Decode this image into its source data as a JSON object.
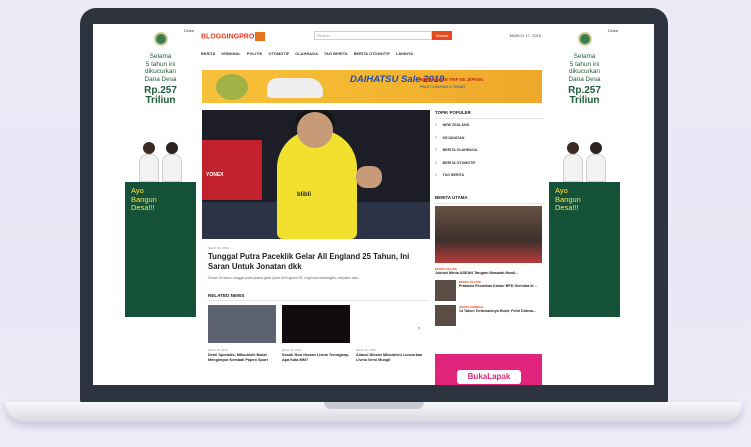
{
  "site": {
    "logo_text": "BLOGGINGPRO",
    "search_placeholder": "Search",
    "search_button": "Search",
    "date": "MARCH 17, 2019"
  },
  "nav": [
    "BERITA",
    "KRIMINAL",
    "POLITIK",
    "OTOMOTIF",
    "OLAHRAGA",
    "TAG BERITA",
    "BERITA OTOMOTIF",
    "LAINNYA"
  ],
  "side_ad": {
    "close": "Close",
    "line1": "Selama",
    "line2": "5 tahun ini",
    "line3": "dikucurkan",
    "line4": "Dana Desa",
    "big1": "Rp.257",
    "big2": "Triliun",
    "green1": "Ayo",
    "green2": "Bangun",
    "green3": "Desa!!!"
  },
  "banner": {
    "brand": "DAIHATSU Sale 2019",
    "sub": "MENANGKAN TRIP KE JEPANG",
    "sub2": "PAKET LIBURAN 4 ORANG"
  },
  "hero": {
    "sponsor": "blibli",
    "board": "YONEX"
  },
  "article": {
    "date": "March 16, 2019",
    "title": "Tunggal Putra Paceklik Gelar All England 25 Tahun, Ini Saran Untuk Jonatan dkk",
    "excerpt": "Sudah 25 tahun tunggal putra puasa gelar juara All England 25. Legenda bulutangkis, meyakini ada..."
  },
  "related": {
    "heading": "RELATED NEWS",
    "items": [
      {
        "date": "March 16, 2019",
        "title": "Demi Sporadis, Mitsubishi Bakal Mengimpor Kembali Pajero Sport"
      },
      {
        "date": "March 16, 2019",
        "title": "Sosok New Nissan Livina Terungkap, Apa Kata MM?"
      },
      {
        "date": "March 16, 2019",
        "title": "Aliansi Nissan Mitsubishi Luncurkan Livina Versi Mungil"
      }
    ]
  },
  "sidebar": {
    "topik_heading": "TOPIK POPULER",
    "topik": [
      "NEW ZEALAND",
      "KEJAHATAN",
      "BERITA OLAHRAGA",
      "BERITA OTOMOTIF",
      "TAG BERITA"
    ],
    "utama_heading": "BERITA UTAMA",
    "utama": [
      {
        "cat": "BERITA POLITIK",
        "title": "Jokowi Minta ASEAN Tangani Masalah Musli..."
      },
      {
        "cat": "BERITA POLITIK",
        "title": "Prabowo Resmikan Kantor BPD Gerindra di ..."
      },
      {
        "cat": "BERITA KRIMINAL",
        "title": "14 Tahun Terbenamnya Munir, Fohri Didesa..."
      }
    ],
    "ad_label": "BukaLapak"
  }
}
